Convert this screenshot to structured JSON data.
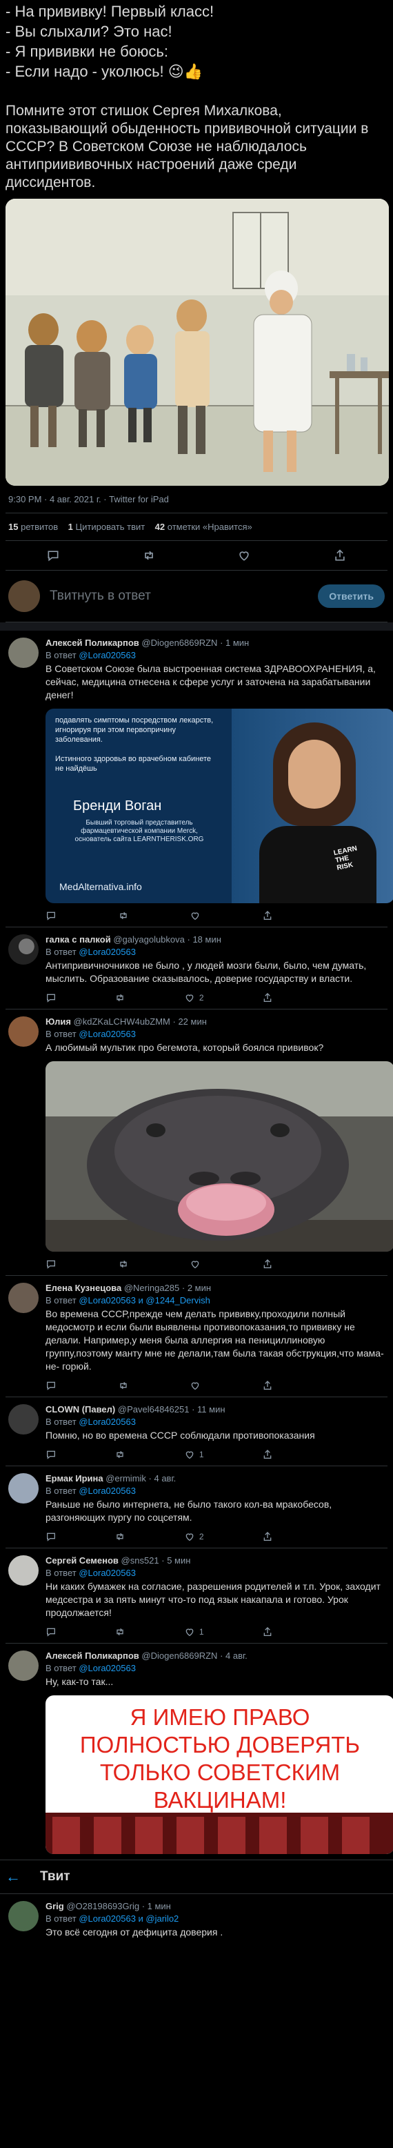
{
  "tweet": {
    "text_lines": "- На прививку! Первый класс!\n- Вы слыхали? Это нас!\n- Я прививки не боюсь:\n- Если надо - уколюсь! 😉👍",
    "text_paragraph": "Помните этот стишок Сергея Михалкова, показывающий обыденность прививочной ситуации в СССР? В Советском Союзе не наблюдалось антиприививочных настроений даже среди диссидентов.",
    "timestamp": "9:30 PM · 4 авг. 2021 г. · Twitter for iPad",
    "retweets_count": "15",
    "retweets_label": "ретвитов",
    "quotes_count": "1",
    "quotes_label": "Цитировать твит",
    "likes_count": "42",
    "likes_label": "отметки «Нравится»"
  },
  "compose": {
    "placeholder": "Твитнуть в ответ",
    "button": "Ответить"
  },
  "replies": [
    {
      "name": "Алексей Поликарпов",
      "handle": "@Diogen6869RZN",
      "time": "· 1 мин",
      "reply_to_prefix": "В ответ",
      "reply_to": "@Lora020563",
      "text": "В Советском Союзе была выстроенная система ЗДРАВООХРАНЕНИЯ, а, сейчас, медицина отнесена к сфере услуг и заточена на зарабатывании денег!",
      "image": {
        "line1": "подавлять симптомы посредством лекарств, игнорируя при этом первопричину заболевания.",
        "line2": "Истинного здоровья во врачебном кабинете не найдёшь",
        "name": "Бренди Воган",
        "caption": "Бывший торговый представитель фармацевтической компании Merck, основатель сайта LEARNTHERISK.ORG",
        "site": "MedAlternativa.info",
        "shirt": "LEARN THE RISK"
      },
      "reply_count": "",
      "retweet_count": "",
      "like_count": ""
    },
    {
      "name": "галка с палкой",
      "handle": "@galyagolubkova",
      "time": "· 18 мин",
      "reply_to_prefix": "В ответ",
      "reply_to": "@Lora020563",
      "text": "Антипривичночников не было , у людей мозги были, было, чем думать, мыслить. Образование сказывалось, доверие государству и власти.",
      "reply_count": "",
      "retweet_count": "",
      "like_count": "2"
    },
    {
      "name": "Юлия",
      "handle": "@kdZKaLCHW4ubZMM",
      "time": "· 22 мин",
      "reply_to_prefix": "В ответ",
      "reply_to": "@Lora020563",
      "text": "А любимый мультик про бегемота, который боялся прививок?",
      "reply_count": "",
      "retweet_count": "",
      "like_count": ""
    },
    {
      "name": "Елена Кузнецова",
      "handle": "@Neringa285",
      "time": "· 2 мин",
      "reply_to_prefix": "В ответ",
      "reply_to": "@Lora020563 и @1244_Dervish",
      "text": "Во времена СССР,прежде чем делать прививку,проходили полный медосмотр и если были выявлены противопоказания,то прививку не делали. Например,у меня была аллергия на пенициллиновую группу,поэтому манту мне не делали,там была такая обструкция,что мама-не- горюй.",
      "reply_count": "",
      "retweet_count": "",
      "like_count": ""
    },
    {
      "name": "CLOWN (Павел)",
      "handle": "@Pavel64846251",
      "time": "· 11 мин",
      "reply_to_prefix": "В ответ",
      "reply_to": "@Lora020563",
      "text": "Помню, но во времена  СССР соблюдали противопоказания",
      "reply_count": "",
      "retweet_count": "",
      "like_count": "1"
    },
    {
      "name": "Ермак Ирина",
      "handle": "@ermimik",
      "time": "· 4 авг.",
      "reply_to_prefix": "В ответ",
      "reply_to": "@Lora020563",
      "text": "Раньше не было интернета, не было такого кол-ва мракобесов, разгоняющих пургу по соцсетям.",
      "reply_count": "",
      "retweet_count": "",
      "like_count": "2"
    },
    {
      "name": "Сергей Семенов",
      "handle": "@sns521",
      "time": "· 5 мин",
      "reply_to_prefix": "В ответ",
      "reply_to": "@Lora020563",
      "text": "Ни каких бумажек на согласие, разрешения родителей и т.п.  Урок, заходит медсестра и за пять минут что-то под язык накапала и готово. Урок продолжается!",
      "reply_count": "",
      "retweet_count": "",
      "like_count": "1"
    },
    {
      "name": "Алексей Поликарпов",
      "handle": "@Diogen6869RZN",
      "time": "· 4 авг.",
      "reply_to_prefix": "В ответ",
      "reply_to": "@Lora020563",
      "text": "Ну, как-то так...",
      "poster": "Я ИМЕЮ ПРАВО ПОЛНОСТЬЮ ДОВЕРЯТЬ ТОЛЬКО СОВЕТСКИМ ВАКЦИНАМ!",
      "reply_count": "",
      "retweet_count": "",
      "like_count": ""
    }
  ],
  "bottom_bar": {
    "title": "Твит"
  },
  "last_reply": {
    "name": "Grig",
    "handle": "@O28198693Grig",
    "time": "· 1 мин",
    "reply_to_prefix": "В ответ",
    "reply_to": "@Lora020563 и @jarilo2",
    "text": "Это всё сегодня от дефицита доверия ."
  },
  "colors": {
    "background": "#000000",
    "text": "#d9d9d9",
    "muted": "#8b98a5",
    "link": "#1d9bf0",
    "divider": "#2f3336",
    "reply_button_bg": "#1b4e70",
    "poster_text": "#e2231a"
  }
}
